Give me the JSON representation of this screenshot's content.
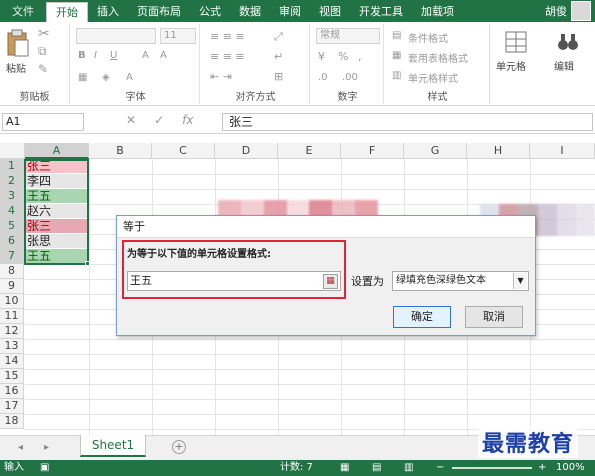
{
  "ribbon_tabs": [
    "文件",
    "开始",
    "插入",
    "页面布局",
    "公式",
    "数据",
    "审阅",
    "视图",
    "开发工具",
    "加载项"
  ],
  "user_name": "胡俊",
  "ribbon": {
    "paste_label": "粘贴",
    "clipboard_label": "剪贴板",
    "font_size": "11",
    "font_label": "字体",
    "alignment_label": "对齐方式",
    "number_format": "常规",
    "number_label": "数字",
    "conditional_format": "条件格式",
    "format_as_table": "套用表格格式",
    "cell_styles": "单元格样式",
    "styles_label": "样式",
    "cells_label": "单元格",
    "edit_label": "编辑"
  },
  "formula_bar": {
    "name_box": "A1",
    "fx": "fx",
    "content": "张三"
  },
  "columns": [
    "A",
    "B",
    "C",
    "D",
    "E",
    "F",
    "G",
    "H",
    "I"
  ],
  "rows": [
    "1",
    "2",
    "3",
    "4",
    "5",
    "6",
    "7",
    "8",
    "9",
    "10",
    "11",
    "12",
    "13",
    "14",
    "15",
    "16",
    "17",
    "18"
  ],
  "cells": [
    "张三",
    "李四",
    "王五",
    "赵六",
    "张三",
    "张思",
    "王五"
  ],
  "dialog": {
    "title": "等于",
    "label": "为等于以下值的单元格设置格式:",
    "input_value": "王五",
    "set_as_label": "设置为",
    "format_option": "绿填充色深绿色文本",
    "ok_label": "确定",
    "cancel_label": "取消"
  },
  "sheet_tab": "Sheet1",
  "watermark": "最需教育",
  "status": {
    "mode": "输入",
    "count": "计数: 7",
    "zoom": "100%"
  },
  "colors": {
    "excel_green": "#217346",
    "dup_fill": "#f4c2c8",
    "dup_text": "#9c0006",
    "green_fill": "#a9d5b3",
    "green_text": "#006100",
    "dialog_highlight": "#e0233a"
  }
}
